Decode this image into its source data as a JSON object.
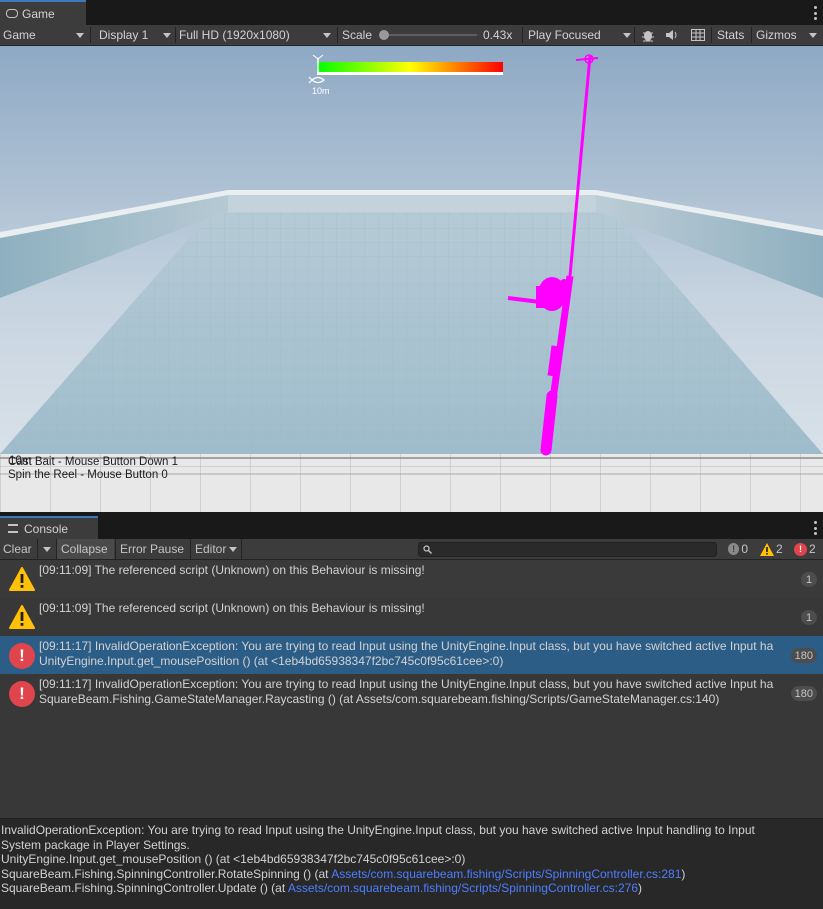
{
  "game_tab": {
    "label": "Game",
    "icon": "gamepad-icon"
  },
  "game_toolbar": {
    "game_dropdown": "Game",
    "display_dropdown": "Display 1",
    "resolution_dropdown": "Full HD (1920x1080)",
    "scale_label": "Scale",
    "scale_value": "0.43x",
    "play_mode_dropdown": "Play Focused",
    "stats_label": "Stats",
    "gizmos_label": "Gizmos"
  },
  "viewport": {
    "distance_label": "10m",
    "hints": [
      "Cast Bait - Mouse Button Down 1",
      "Spin the Reel - Mouse Button 0"
    ],
    "rod_color": "#ff00ff",
    "meter_colors": [
      "#00ff00",
      "#ffff00",
      "#ff0000"
    ]
  },
  "console_tab": {
    "label": "Console"
  },
  "console_toolbar": {
    "clear_label": "Clear",
    "collapse_label": "Collapse",
    "error_pause_label": "Error Pause",
    "editor_label": "Editor",
    "info_count": "0",
    "warning_count": "2",
    "error_count": "2"
  },
  "console_rows": [
    {
      "type": "warning",
      "line1": "[09:11:09] The referenced script (Unknown) on this Behaviour is missing!",
      "line2": "",
      "count": "1"
    },
    {
      "type": "warning",
      "line1": "[09:11:09] The referenced script (Unknown) on this Behaviour is missing!",
      "line2": "",
      "count": "1"
    },
    {
      "type": "error",
      "line1": "[09:11:17] InvalidOperationException: You are trying to read Input using the UnityEngine.Input class, but you have switched active Input ha",
      "line2": "UnityEngine.Input.get_mousePosition () (at <1eb4bd65938347f2bc745c0f95c61cee>:0)",
      "count": "180"
    },
    {
      "type": "error",
      "line1": "[09:11:17] InvalidOperationException: You are trying to read Input using the UnityEngine.Input class, but you have switched active Input ha",
      "line2": "SquareBeam.Fishing.GameStateManager.Raycasting () (at Assets/com.squarebeam.fishing/Scripts/GameStateManager.cs:140)",
      "count": "180"
    }
  ],
  "detail": {
    "line1": "InvalidOperationException: You are trying to read Input using the UnityEngine.Input class, but you have switched active Input handling to Input",
    "line2": "System package in Player Settings.",
    "line3": "UnityEngine.Input.get_mousePosition () (at <1eb4bd65938347f2bc745c0f95c61cee>:0)",
    "line4_prefix": "SquareBeam.Fishing.SpinningController.RotateSpinning () (at ",
    "line4_link": "Assets/com.squarebeam.fishing/Scripts/SpinningController.cs:281",
    "line4_suffix": ")",
    "line5_prefix": "SquareBeam.Fishing.SpinningController.Update () (at ",
    "line5_link": "Assets/com.squarebeam.fishing/Scripts/SpinningController.cs:276",
    "line5_suffix": ")"
  },
  "colors": {
    "selected_row": "#2c5d87",
    "warning": "#ffc107",
    "error": "#e0444c",
    "link": "#4c7eff"
  }
}
